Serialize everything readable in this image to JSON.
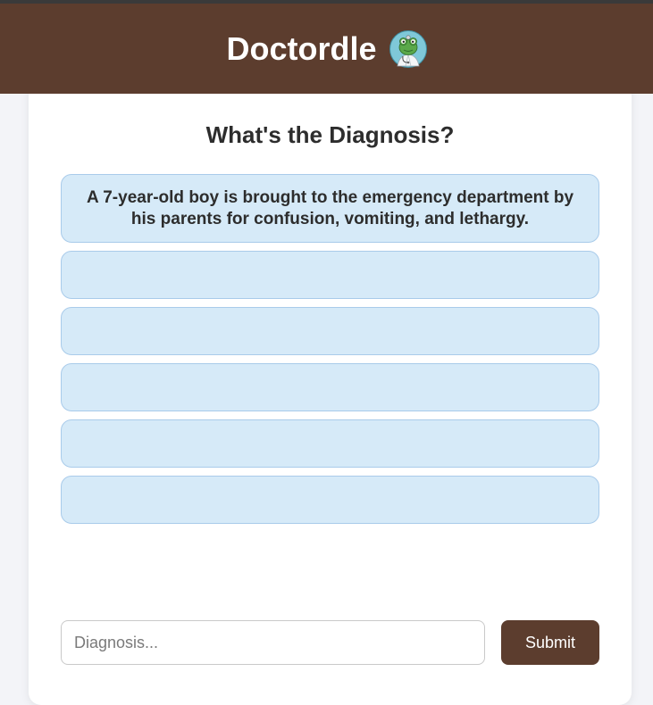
{
  "header": {
    "title": "Doctordle",
    "logo_icon": "doctor-frog-mascot-icon"
  },
  "game": {
    "question": "What's the Diagnosis?",
    "clues": [
      "A 7-year-old boy is brought to the emergency department by his parents for confusion, vomiting, and lethargy.",
      "",
      "",
      "",
      "",
      ""
    ]
  },
  "guess": {
    "placeholder": "Diagnosis...",
    "value": "",
    "submit_label": "Submit"
  },
  "colors": {
    "header_bg": "#5c3d2e",
    "clue_bg": "#d6eaf8",
    "clue_border": "#a9cbea",
    "button_bg": "#5c3d2e"
  }
}
